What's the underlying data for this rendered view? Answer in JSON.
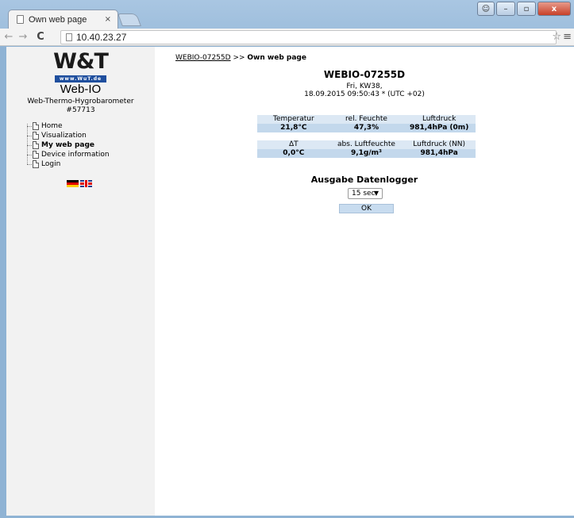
{
  "browser": {
    "tab_title": "Own web page",
    "tab_close": "×",
    "url": "10.40.23.27",
    "back": "←",
    "forward": "→",
    "reload": "C",
    "star": "☆",
    "menu": "≡",
    "win_minimize": "–",
    "win_maximize": "▫",
    "win_close": "x"
  },
  "sidebar": {
    "logo_main": "W&T",
    "logo_url": "www.WuT.de",
    "logo_product": "Web-IO",
    "device_desc": "Web-Thermo-Hygrobarometer",
    "device_num": "#57713",
    "nav": [
      {
        "label": "Home"
      },
      {
        "label": "Visualization"
      },
      {
        "label": "My web page"
      },
      {
        "label": "Device information"
      },
      {
        "label": "Login"
      }
    ]
  },
  "main": {
    "breadcrumb_link": "WEBIO-07255D",
    "breadcrumb_sep": ">>",
    "breadcrumb_current": "Own web page",
    "device_name": "WEBIO-07255D",
    "date_line1": "Fri, KW38,",
    "date_line2": "18.09.2015 09:50:43 * (UTC +02)",
    "table1": {
      "headers": [
        "Temperatur",
        "rel. Feuchte",
        "Luftdruck"
      ],
      "values": [
        "21,8°C",
        "47,3%",
        "981,4hPa (0m)"
      ]
    },
    "table2": {
      "headers": [
        "ΔT",
        "abs. Luftfeuchte",
        "Luftdruck (NN)"
      ],
      "values": [
        "0,0°C",
        "9,1g/m³",
        "981,4hPa"
      ]
    },
    "logger_title": "Ausgabe Datenlogger",
    "logger_select": "15 sec",
    "ok_label": "OK"
  }
}
